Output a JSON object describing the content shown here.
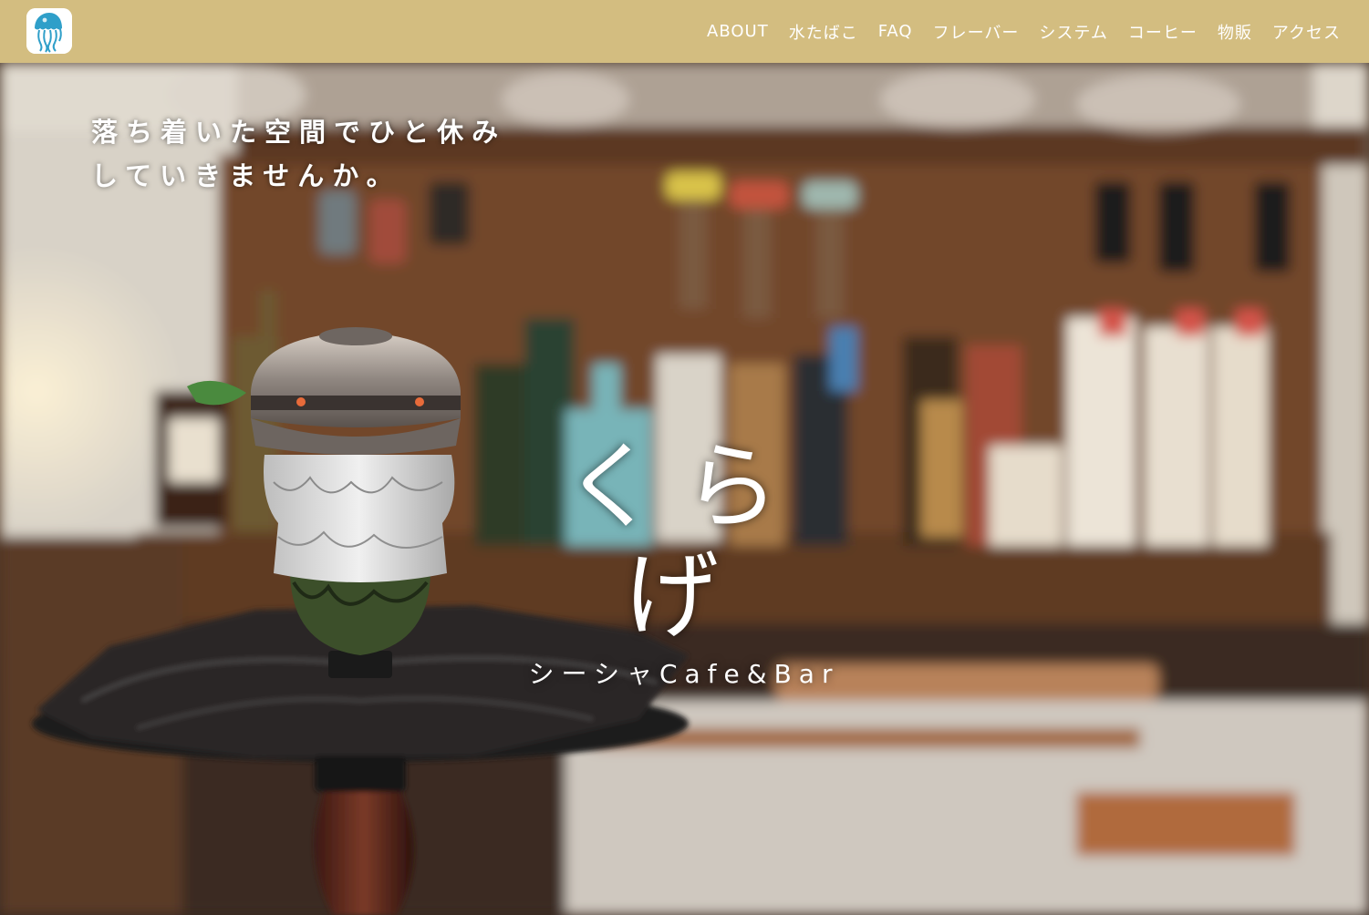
{
  "header": {
    "logo_icon": "jellyfish-icon",
    "bg_color": "#d3bd80",
    "nav": [
      {
        "label": "ABOUT"
      },
      {
        "label": "水たばこ"
      },
      {
        "label": "FAQ"
      },
      {
        "label": "フレーバー"
      },
      {
        "label": "システム"
      },
      {
        "label": "コーヒー"
      },
      {
        "label": "物販"
      },
      {
        "label": "アクセス"
      }
    ]
  },
  "hero": {
    "tagline": [
      "落ち着いた空間でひと休み",
      "していきませんか。"
    ],
    "brand_name": "くらげ",
    "brand_sub": "シーシャCafe&Bar",
    "background_image": "blurred bar shelf with liquor bottles and a shisha hookah in the foreground"
  }
}
